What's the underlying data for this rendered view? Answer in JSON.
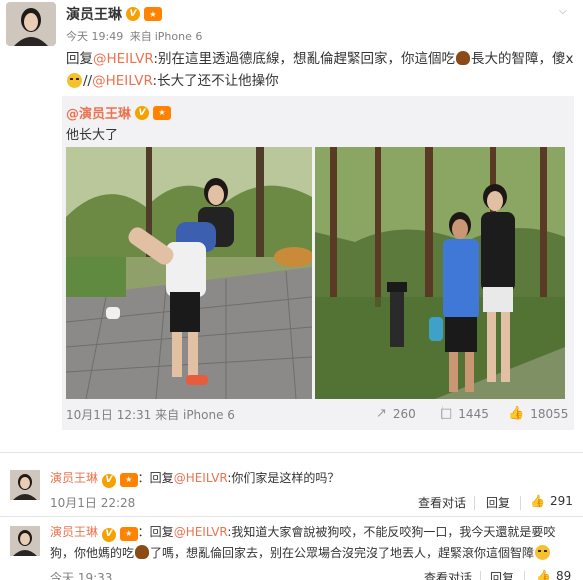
{
  "post": {
    "author": "演员王琳",
    "verified_badge": "V",
    "level_badge": "lv",
    "time": "今天 19:49",
    "source_prefix": "来自",
    "source": "iPhone 6",
    "text_reply": "回复",
    "text_mention1": "@HEILVR",
    "text_part1": ":别在這里透過德底線，想亂倫趕緊回家，你這個吃",
    "text_part2": "長大的智障，傻x",
    "text_part3": "//",
    "text_mention2": "@HEILVR",
    "text_part4": ":长大了还不让他操你"
  },
  "repost": {
    "author": "@演员王琳",
    "text": "他长大了",
    "date": "10月1日 12:31",
    "source_prefix": "来自",
    "source": "iPhone 6",
    "reposts": "260",
    "comments": "1445",
    "likes": "18055"
  },
  "comments": [
    {
      "author": "演员王琳",
      "reply_label": "：回复",
      "mention": "@HEILVR",
      "text": ":你们家是这样的吗？",
      "date": "10月1日 22:28",
      "view_thread": "查看对话",
      "reply": "回复",
      "likes": "291"
    },
    {
      "author": "演员王琳",
      "reply_label": "：回复",
      "mention": "@HEILVR",
      "text_a": ":我知道大家會說被狗咬，不能反咬狗一口，我今天還就是要咬",
      "text_b": "狗，你他媽的吃",
      "text_c": "了嗎，想亂倫回家去，别在公眾場合沒完沒了地丟人，趕緊滾你這個智障",
      "date": "今天 19:33",
      "view_thread": "查看对话",
      "reply": "回复",
      "likes": "89"
    }
  ],
  "icons": [
    "verified-icon",
    "level-icon",
    "chevron-down-icon",
    "repost-icon",
    "comment-icon",
    "like-icon",
    "poop-emoji-icon",
    "angry-emoji-icon"
  ],
  "colors": {
    "link": "#eb7350",
    "repost_bg": "#f2f2f5",
    "meta": "#808080"
  }
}
